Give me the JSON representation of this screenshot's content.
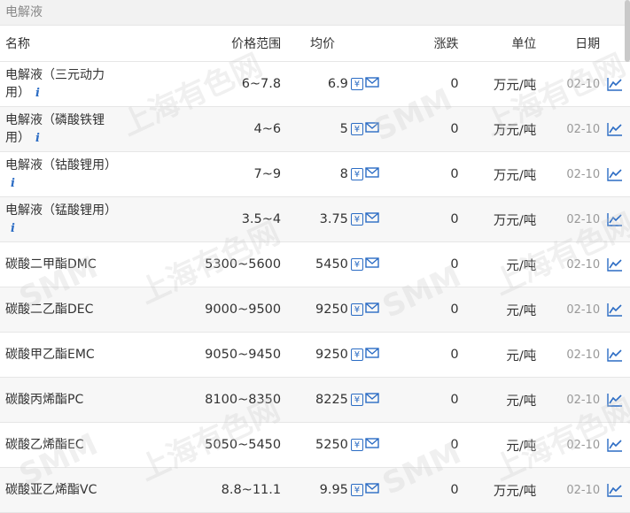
{
  "section_title": "电解液",
  "columns": {
    "name": "名称",
    "range": "价格范围",
    "avg": "均价",
    "change": "涨跌",
    "unit": "单位",
    "date": "日期"
  },
  "rows": [
    {
      "name_line1": "电解液（三元动力",
      "name_line2": "用）",
      "has_info": true,
      "range": "6~7.8",
      "avg": "6.9",
      "change": "0",
      "unit": "万元/吨",
      "date": "02-10"
    },
    {
      "name_line1": "电解液（磷酸铁锂",
      "name_line2": "用）",
      "has_info": true,
      "range": "4~6",
      "avg": "5",
      "change": "0",
      "unit": "万元/吨",
      "date": "02-10"
    },
    {
      "name_line1": "电解液（钴酸锂用）",
      "name_line2": "",
      "has_info": true,
      "range": "7~9",
      "avg": "8",
      "change": "0",
      "unit": "万元/吨",
      "date": "02-10"
    },
    {
      "name_line1": "电解液（锰酸锂用）",
      "name_line2": "",
      "has_info": true,
      "range": "3.5~4",
      "avg": "3.75",
      "change": "0",
      "unit": "万元/吨",
      "date": "02-10"
    },
    {
      "name_line1": "碳酸二甲酯DMC",
      "name_line2": "",
      "has_info": false,
      "range": "5300~5600",
      "avg": "5450",
      "change": "0",
      "unit": "元/吨",
      "date": "02-10"
    },
    {
      "name_line1": "碳酸二乙酯DEC",
      "name_line2": "",
      "has_info": false,
      "range": "9000~9500",
      "avg": "9250",
      "change": "0",
      "unit": "元/吨",
      "date": "02-10"
    },
    {
      "name_line1": "碳酸甲乙酯EMC",
      "name_line2": "",
      "has_info": false,
      "range": "9050~9450",
      "avg": "9250",
      "change": "0",
      "unit": "元/吨",
      "date": "02-10"
    },
    {
      "name_line1": "碳酸丙烯酯PC",
      "name_line2": "",
      "has_info": false,
      "range": "8100~8350",
      "avg": "8225",
      "change": "0",
      "unit": "元/吨",
      "date": "02-10"
    },
    {
      "name_line1": "碳酸乙烯酯EC",
      "name_line2": "",
      "has_info": false,
      "range": "5050~5450",
      "avg": "5250",
      "change": "0",
      "unit": "元/吨",
      "date": "02-10"
    },
    {
      "name_line1": "碳酸亚乙烯酯VC",
      "name_line2": "",
      "has_info": false,
      "range": "8.8~11.1",
      "avg": "9.95",
      "change": "0",
      "unit": "万元/吨",
      "date": "02-10"
    }
  ],
  "icons": {
    "price_icon": "yen-icon",
    "mail_icon": "mail-icon",
    "chart_icon": "trend-chart-icon",
    "info_icon": "info-icon",
    "info_glyph": "i",
    "yen_glyph": "¥"
  },
  "colors": {
    "accent": "#2b6cc4",
    "stripe": "#f7f7f7"
  },
  "watermark": {
    "brand": "SMM",
    "text": "上海有色网"
  }
}
